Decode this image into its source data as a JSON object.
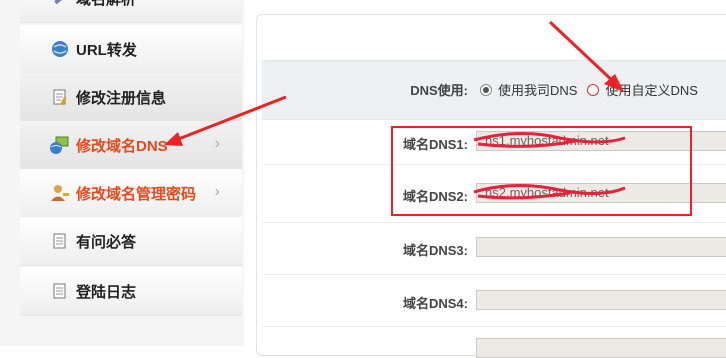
{
  "sidebar": {
    "items": [
      {
        "label": "域名解析",
        "icon": "wrench-icon",
        "active": false
      },
      {
        "label": "URL转发",
        "icon": "globe-icon",
        "active": false
      },
      {
        "label": "修改注册信息",
        "icon": "document-edit-icon",
        "active": false
      },
      {
        "label": "修改域名DNS",
        "icon": "network-icon",
        "active": true
      },
      {
        "label": "修改域名管理密码",
        "icon": "user-key-icon",
        "active": true
      },
      {
        "label": "有问必答",
        "icon": "document-icon",
        "active": false
      },
      {
        "label": "登陆日志",
        "icon": "document-icon",
        "active": false
      }
    ],
    "chevron": "›"
  },
  "form": {
    "dns_use_label": "DNS使用:",
    "option_system": "使用我司DNS",
    "option_custom": "使用自定义DNS",
    "selected": "system",
    "fields": [
      {
        "label": "域名DNS1:",
        "value": "ns1.myhostadmin.net"
      },
      {
        "label": "域名DNS2:",
        "value": "ns2.myhostadmin.net"
      },
      {
        "label": "域名DNS3:",
        "value": ""
      },
      {
        "label": "域名DNS4:",
        "value": ""
      }
    ]
  },
  "annotation": {
    "highlight_color": "#e22222",
    "scribble_color": "#e8203a"
  }
}
